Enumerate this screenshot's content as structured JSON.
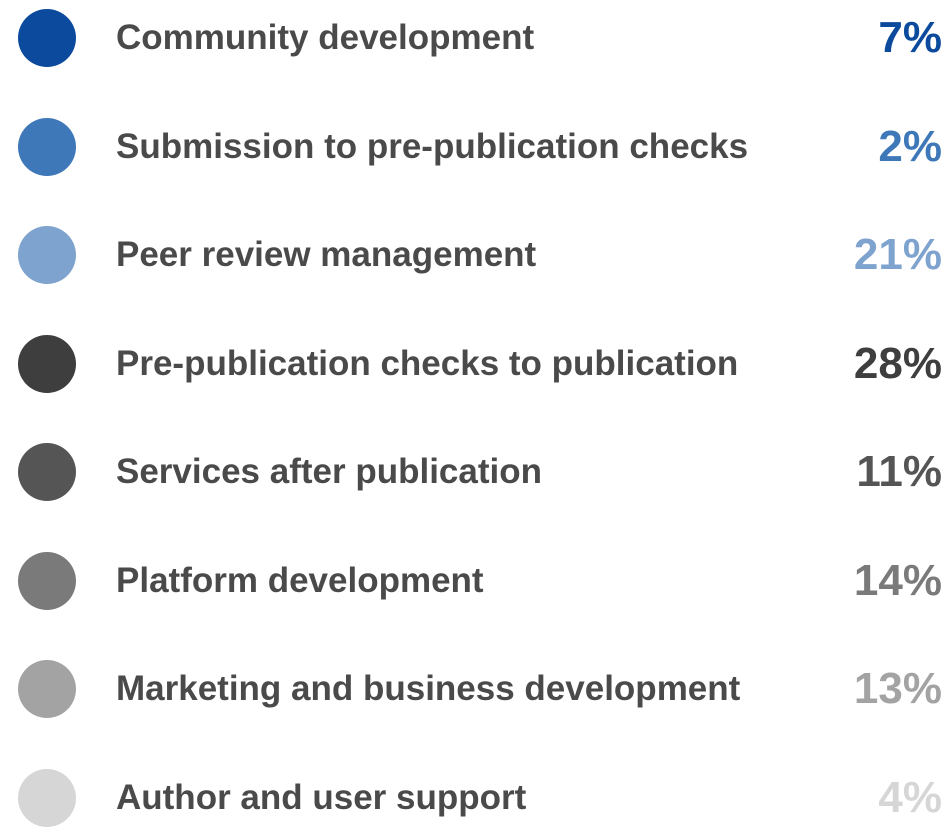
{
  "chart_data": {
    "type": "pie",
    "title": "",
    "legend_position": "right",
    "categories": [
      "Community development",
      "Submission to pre-publication checks",
      "Peer review management",
      "Pre-publication checks to publication",
      "Services after publication",
      "Platform development",
      "Marketing and business development",
      "Author and user support"
    ],
    "values": [
      7,
      2,
      21,
      28,
      11,
      14,
      13,
      4
    ],
    "value_labels": [
      "7%",
      "2%",
      "21%",
      "28%",
      "11%",
      "14%",
      "13%",
      "4%"
    ],
    "unit": "%",
    "colors": [
      "#0b4a9c",
      "#3e78b8",
      "#7ea3cf",
      "#3e3e3e",
      "#555555",
      "#7a7a7a",
      "#a3a3a3",
      "#d6d6d6"
    ]
  }
}
